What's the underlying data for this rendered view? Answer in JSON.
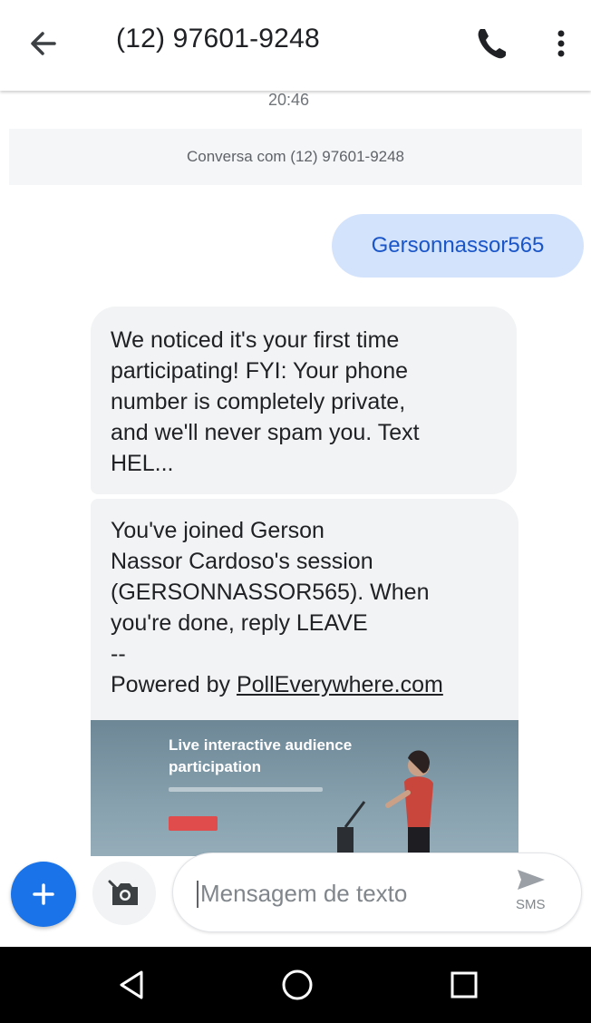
{
  "header": {
    "title": "(12) 97601-9248",
    "back_icon": "arrow-back-icon",
    "call_icon": "phone-icon",
    "menu_icon": "more-vert-icon"
  },
  "thread": {
    "timestamp": "20:46",
    "conversation_label": "Conversa com (12) 97601-9248",
    "messages": [
      {
        "direction": "outgoing",
        "text": "Gersonnassor565"
      },
      {
        "direction": "incoming",
        "lines": [
          "We noticed it's your first time",
          "participating! FYI: Your phone",
          "number is completely private,",
          "and we'll never spam you. Text",
          "HEL..."
        ]
      },
      {
        "direction": "incoming",
        "lines": [
          "You've joined Gerson",
          "Nassor Cardoso's session",
          "(GERSONNASSOR565). When",
          "you're done, reply LEAVE",
          "--"
        ],
        "powered_prefix": "Powered by ",
        "powered_link": "PollEverywhere.com"
      }
    ],
    "link_preview": {
      "title_line1": "Live interactive audience",
      "title_line2": "participation"
    }
  },
  "compose": {
    "placeholder": "Mensagem de texto",
    "send_label": "SMS",
    "add_icon": "plus-icon",
    "camera_icon": "camera-icon",
    "send_icon": "send-icon"
  },
  "system_nav": {
    "back_icon": "nav-back-icon",
    "home_icon": "nav-home-icon",
    "recents_icon": "nav-recents-icon"
  },
  "colors": {
    "accent": "#1a73e8",
    "outgoing_bubble": "#d4e3fc",
    "outgoing_text": "#1a56c9",
    "incoming_bubble": "#f1f3f4"
  }
}
